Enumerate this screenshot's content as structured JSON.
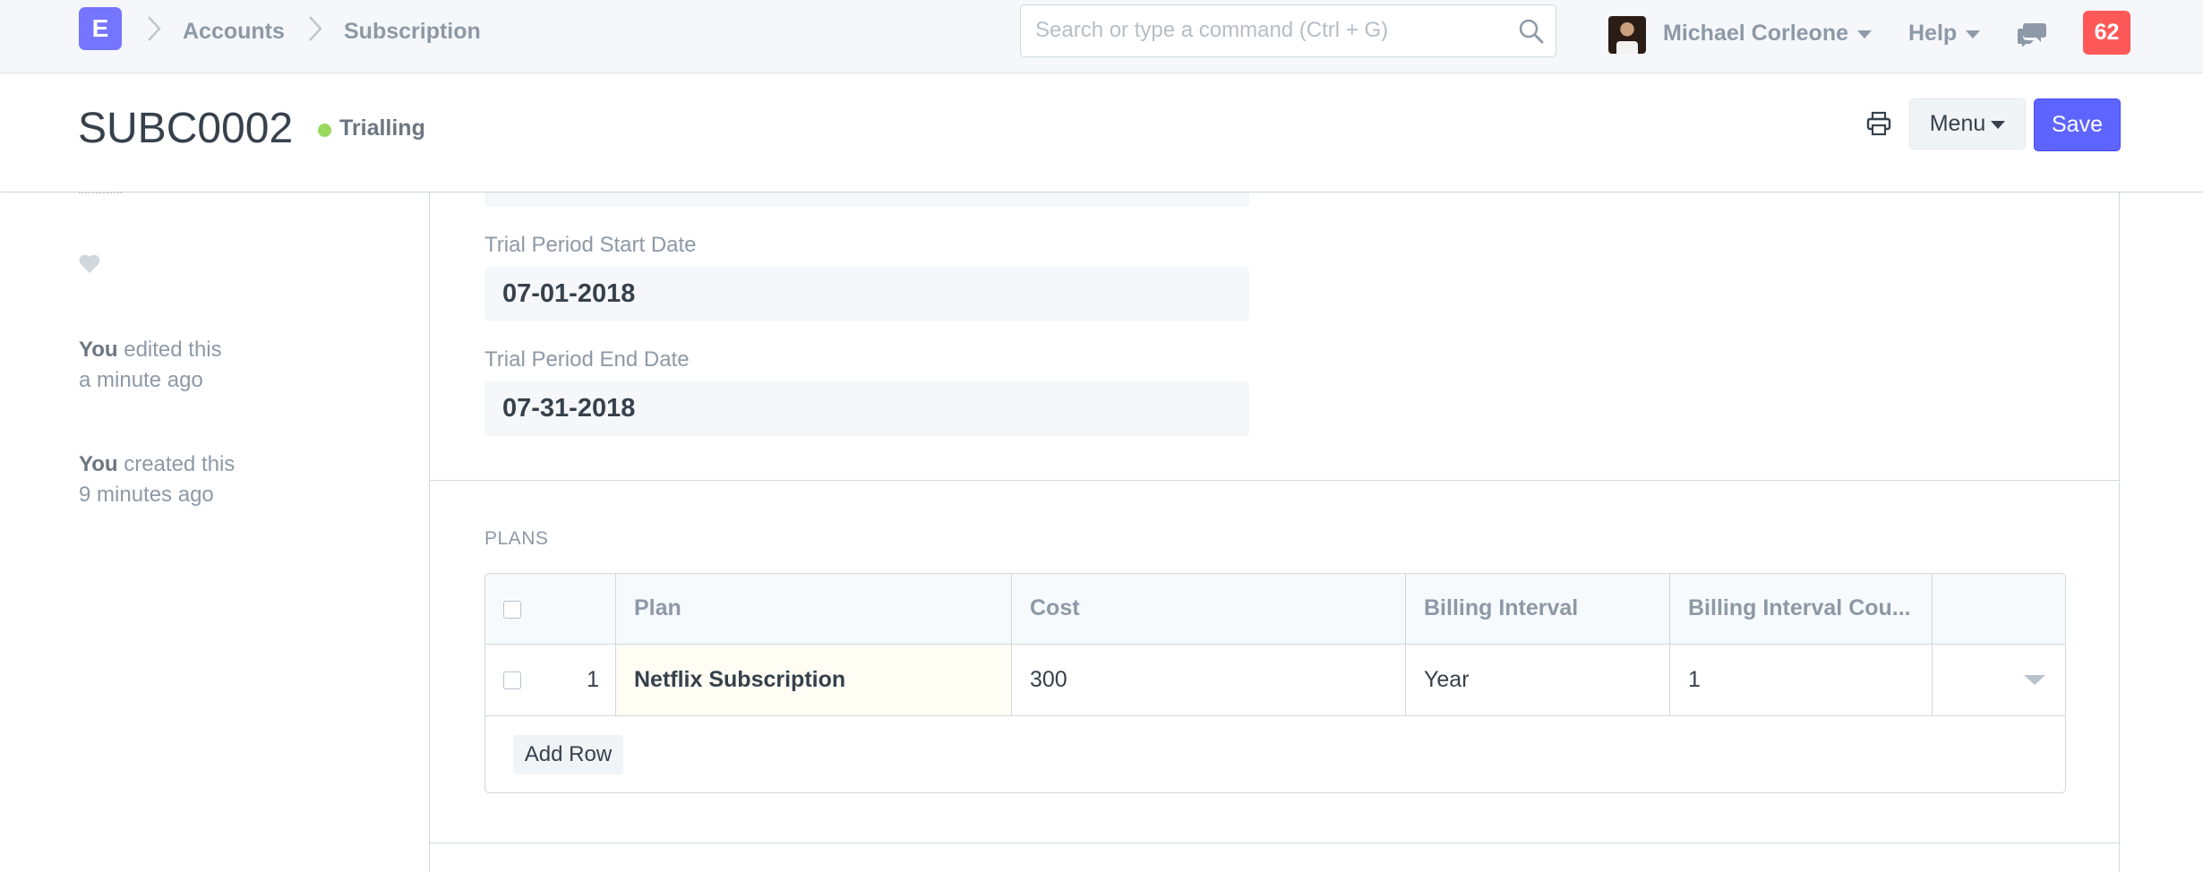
{
  "navbar": {
    "logo_letter": "E",
    "breadcrumbs": [
      "Accounts",
      "Subscription"
    ],
    "search_placeholder": "Search or type a command (Ctrl + G)",
    "user_name": "Michael Corleone",
    "help_label": "Help",
    "notification_count": "62"
  },
  "page_head": {
    "title": "SUBC0002",
    "status": "Trialling",
    "menu_label": "Menu",
    "save_label": "Save"
  },
  "sidebar": {
    "timeline": [
      {
        "actor": "You",
        "action": "edited this",
        "when": "a minute ago"
      },
      {
        "actor": "You",
        "action": "created this",
        "when": "9 minutes ago"
      }
    ]
  },
  "form": {
    "trial_start": {
      "label": "Trial Period Start Date",
      "value": "07-01-2018"
    },
    "trial_end": {
      "label": "Trial Period End Date",
      "value": "07-31-2018"
    }
  },
  "plans": {
    "section_label": "PLANS",
    "columns": [
      "Plan",
      "Cost",
      "Billing Interval",
      "Billing Interval Cou..."
    ],
    "rows": [
      {
        "idx": "1",
        "plan": "Netflix Subscription",
        "cost": "300",
        "billing_interval": "Year",
        "billing_interval_count": "1"
      }
    ],
    "add_row_label": "Add Row"
  },
  "colors": {
    "primary": "#5e64ff",
    "logo": "#7575ff",
    "badge": "#ff5858",
    "status_dot": "#98d85b"
  },
  "icons": [
    "chevron-right-icon",
    "search-icon",
    "caret-down-icon",
    "chat-icon",
    "print-icon",
    "heart-icon",
    "checkbox-icon"
  ]
}
